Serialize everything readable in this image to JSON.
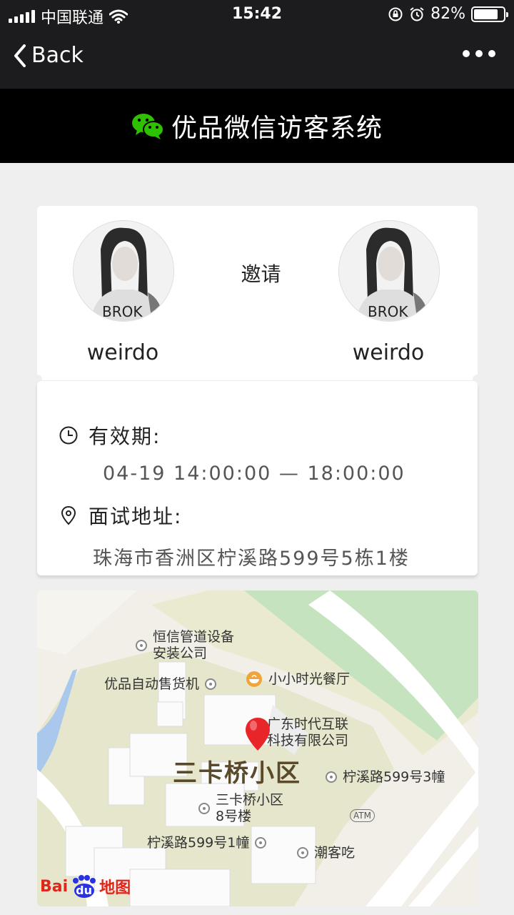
{
  "status_bar": {
    "carrier": "中国联通",
    "time": "15:42",
    "battery_pct": "82%",
    "battery_level": 0.82
  },
  "nav": {
    "back_label": "Back"
  },
  "header": {
    "title": "优品微信访客系统"
  },
  "invite": {
    "host_name": "weirdo",
    "action_label": "邀请",
    "guest_name": "weirdo"
  },
  "details": {
    "validity_label": "有效期:",
    "validity_value": "04-19 14:00:00 — 18:00:00",
    "address_label": "面试地址:",
    "address_value": "珠海市香洲区柠溪路599号5栋1楼"
  },
  "map": {
    "district": "三卡桥小区",
    "poi_1_line1": "恒信管道设备",
    "poi_1_line2": "安装公司",
    "poi_2": "优品自动售货机",
    "poi_3": "小小时光餐厅",
    "poi_4_line1": "广东时代互联",
    "poi_4_line2": "科技有限公司",
    "poi_5": "柠溪路599号3幢",
    "poi_6_line1": "三卡桥小区",
    "poi_6_line2": "8号楼",
    "poi_7": "柠溪路599号1幢",
    "poi_8": "潮客吃",
    "atm": "ATM",
    "logo_bai": "Bai",
    "logo_du": "du",
    "logo_map": "地图"
  },
  "colors": {
    "wechat_green": "#2dc100",
    "pin_red": "#e8262a",
    "map_green": "#c6e3c0",
    "map_water": "#a9c8ec"
  }
}
